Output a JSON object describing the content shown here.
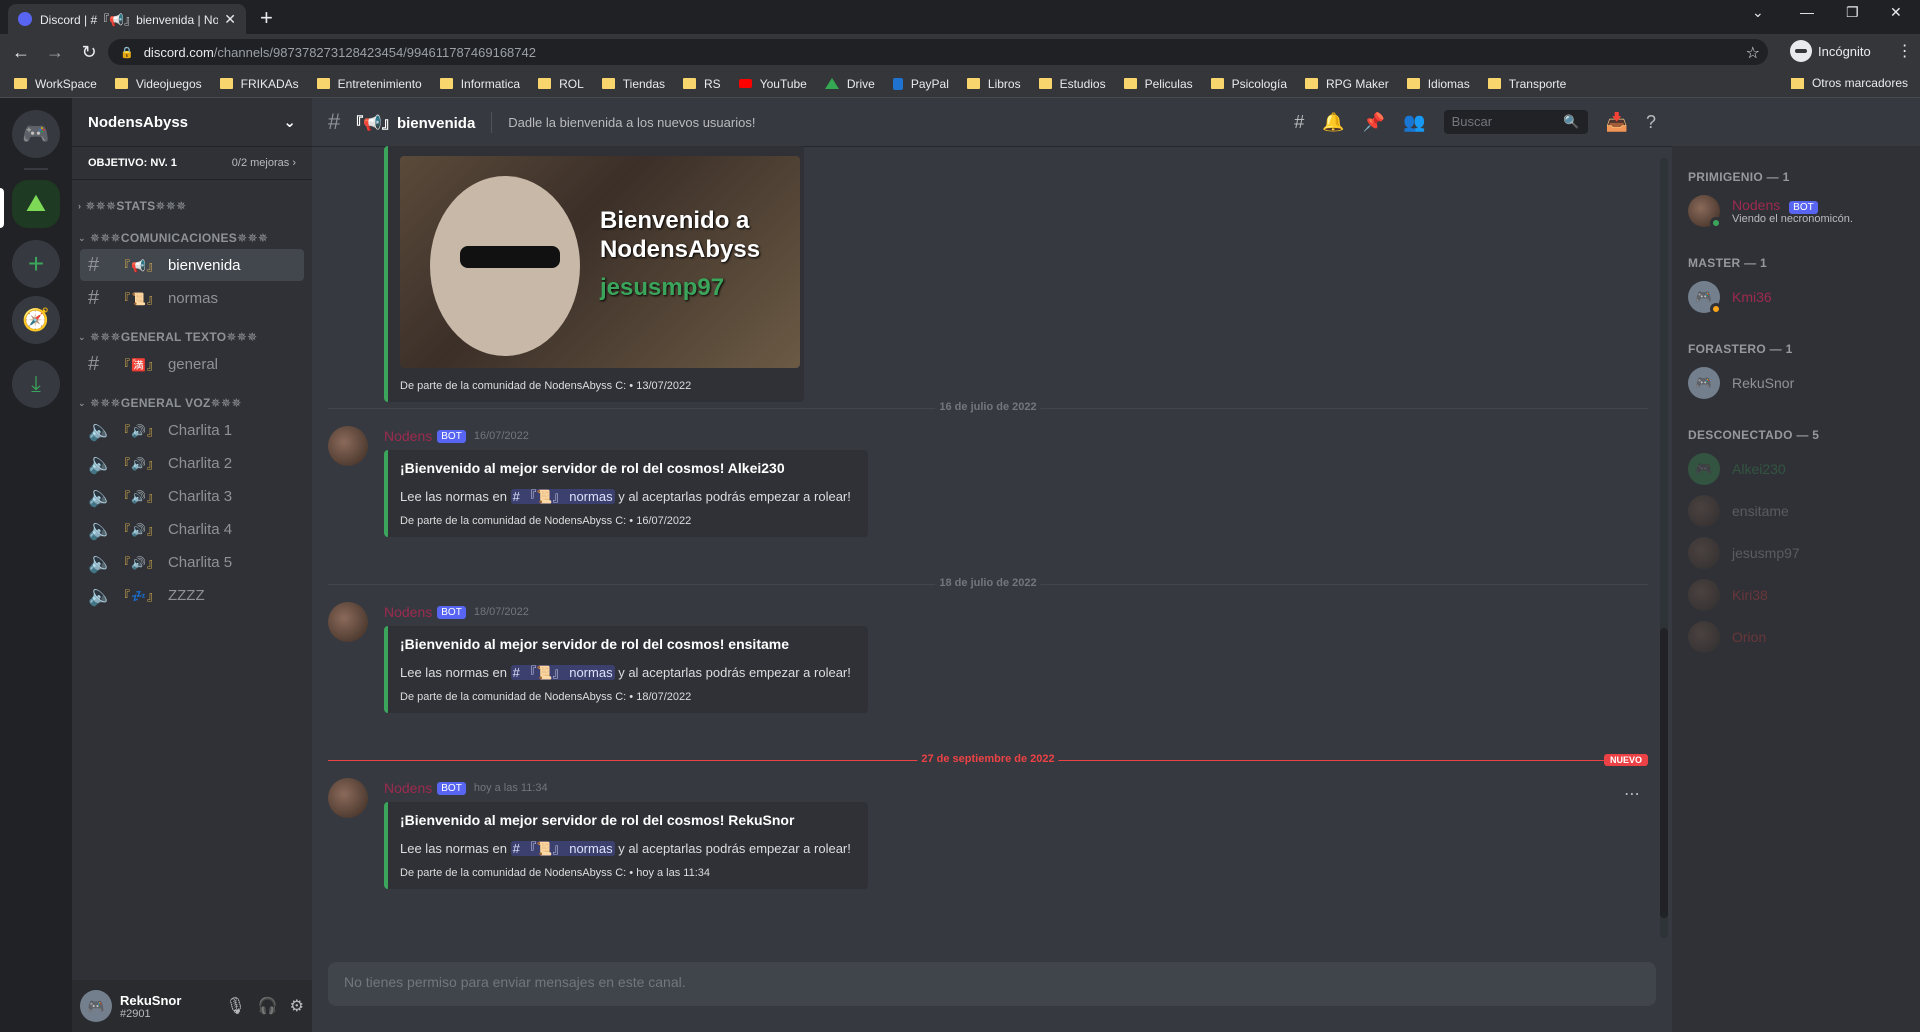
{
  "browser": {
    "tab_title": "Discord | #『📢』bienvenida | No",
    "url_domain": "discord.com",
    "url_path": "/channels/987378273128423454/994611787469168742",
    "incognito_label": "Incógnito",
    "bookmarks": [
      "WorkSpace",
      "Videojuegos",
      "FRIKADAs",
      "Entretenimiento",
      "Informatica",
      "ROL",
      "Tiendas",
      "RS",
      "YouTube",
      "Drive",
      "PayPal",
      "Libros",
      "Estudios",
      "Peliculas",
      "Psicología",
      "RPG Maker",
      "Idiomas",
      "Transporte"
    ],
    "other_bookmarks": "Otros marcadores"
  },
  "server": {
    "name": "NodensAbyss",
    "boost_goal": "OBJETIVO: NV. 1",
    "boost_progress": "0/2 mejoras",
    "categories": {
      "stats": "✵✵✵STATS✵✵✵",
      "comunicaciones": "✵✵✵COMUNICACIONES✵✵✵",
      "general_texto": "✵✵✵GENERAL TEXTO✵✵✵",
      "general_voz": "✵✵✵GENERAL VOZ✵✵✵"
    },
    "channels": {
      "bienvenida": "bienvenida",
      "normas": "normas",
      "general": "general",
      "voice": [
        "Charlita 1",
        "Charlita 2",
        "Charlita 3",
        "Charlita 4",
        "Charlita 5",
        "ZZZZ"
      ]
    }
  },
  "user": {
    "name": "RekuSnor",
    "tag": "#2901"
  },
  "channel": {
    "name": "bienvenida",
    "topic": "Dadle la bienvenida a los nuevos usuarios!",
    "search_placeholder": "Buscar",
    "composer_placeholder": "No tienes permiso para enviar mensajes en este canal."
  },
  "messages": {
    "welcome_image": {
      "line1": "Bienvenido a",
      "line2": "NodensAbyss",
      "username": "jesusmp97"
    },
    "first_footer": "De parte de la comunidad de NodensAbyss C: • 13/07/2022",
    "dividers": [
      "16 de julio de 2022",
      "18 de julio de 2022",
      "27 de septiembre de 2022"
    ],
    "new_label": "NUEVO",
    "bot_label": "BOT",
    "author": "Nodens",
    "items": [
      {
        "timestamp": "16/07/2022",
        "title": "¡Bienvenido al mejor servidor de rol del cosmos! Alkei230",
        "desc_before": "Lee las normas en",
        "mention": "# 『📜』 normas",
        "desc_after": "y al aceptarlas podrás empezar a rolear!",
        "footer": "De parte de la comunidad de NodensAbyss C: • 16/07/2022"
      },
      {
        "timestamp": "18/07/2022",
        "title": "¡Bienvenido al mejor servidor de rol del cosmos! ensitame",
        "desc_before": "Lee las normas en",
        "mention": "# 『📜』 normas",
        "desc_after": "y al aceptarlas podrás empezar a rolear!",
        "footer": "De parte de la comunidad de NodensAbyss C: • 18/07/2022"
      },
      {
        "timestamp": "hoy a las 11:34",
        "title": "¡Bienvenido al mejor servidor de rol del cosmos! RekuSnor",
        "desc_before": "Lee las normas en",
        "mention": "# 『📜』 normas",
        "desc_after": "y al aceptarlas podrás empezar a rolear!",
        "footer": "De parte de la comunidad de NodensAbyss C: • hoy a las 11:34"
      }
    ]
  },
  "members": {
    "groups": [
      {
        "label": "PRIMIGENIO — 1",
        "members": [
          {
            "name": "Nodens",
            "bot": true,
            "status": "Viendo el necronomicón.",
            "color": "#9e2a4f"
          }
        ]
      },
      {
        "label": "MASTER — 1",
        "members": [
          {
            "name": "Kmi36",
            "color": "#9e2a4f"
          }
        ]
      },
      {
        "label": "FORASTERO — 1",
        "members": [
          {
            "name": "RekuSnor",
            "color": "#8e9297"
          }
        ]
      },
      {
        "label": "DESCONECTADO — 5",
        "members": [
          {
            "name": "Alkei230",
            "color": "#3ba55c"
          },
          {
            "name": "ensitame",
            "color": "#b9bbbe"
          },
          {
            "name": "jesusmp97",
            "color": "#b9bbbe"
          },
          {
            "name": "Kiri38",
            "color": "#ed4245"
          },
          {
            "name": "Orion",
            "color": "#ed4245"
          }
        ]
      }
    ]
  }
}
